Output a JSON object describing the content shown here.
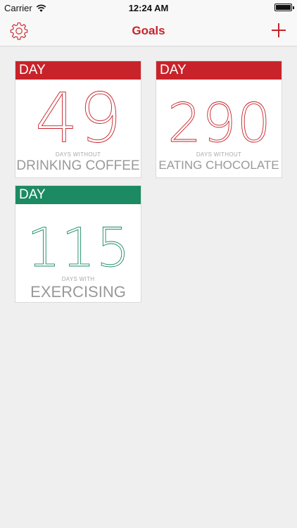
{
  "status_bar": {
    "carrier": "Carrier",
    "time": "12:24 AM"
  },
  "nav": {
    "title": "Goals",
    "settings_icon": "gear-icon",
    "add_icon": "plus-icon"
  },
  "colors": {
    "brand_red": "#c8232a",
    "green": "#1c8a63",
    "background": "#efefef"
  },
  "goals": [
    {
      "header": "DAY",
      "count": "49",
      "caption": "DAYS WITHOUT",
      "goal": "DRINKING COFFEE",
      "color": "#c8232a"
    },
    {
      "header": "DAY",
      "count": "290",
      "caption": "DAYS WITHOUT",
      "goal": "EATING CHOCOLATE",
      "color": "#c8232a"
    },
    {
      "header": "DAY",
      "count": "115",
      "caption": "DAYS WITH",
      "goal": "EXERCISING",
      "color": "#1c8a63"
    }
  ]
}
